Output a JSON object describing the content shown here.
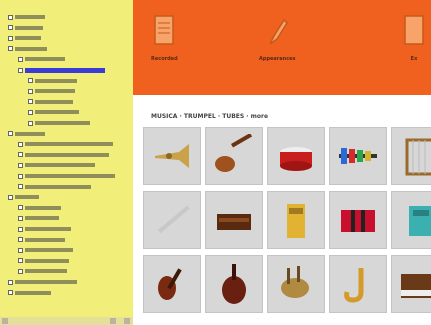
{
  "sidebar": {
    "items": [
      {
        "depth": 0,
        "w": 30
      },
      {
        "depth": 0,
        "w": 28
      },
      {
        "depth": 0,
        "w": 26
      },
      {
        "depth": 0,
        "w": 32
      },
      {
        "depth": 1,
        "w": 40
      },
      {
        "depth": 1,
        "w": 80,
        "selected": true
      },
      {
        "depth": 2,
        "w": 42
      },
      {
        "depth": 2,
        "w": 40
      },
      {
        "depth": 2,
        "w": 38
      },
      {
        "depth": 2,
        "w": 44
      },
      {
        "depth": 2,
        "w": 55
      },
      {
        "depth": 0,
        "w": 30
      },
      {
        "depth": 1,
        "w": 88
      },
      {
        "depth": 1,
        "w": 84
      },
      {
        "depth": 1,
        "w": 70
      },
      {
        "depth": 1,
        "w": 90
      },
      {
        "depth": 1,
        "w": 66
      },
      {
        "depth": 0,
        "w": 24
      },
      {
        "depth": 1,
        "w": 36
      },
      {
        "depth": 1,
        "w": 34
      },
      {
        "depth": 1,
        "w": 46
      },
      {
        "depth": 1,
        "w": 40
      },
      {
        "depth": 1,
        "w": 48
      },
      {
        "depth": 1,
        "w": 44
      },
      {
        "depth": 1,
        "w": 42
      },
      {
        "depth": 0,
        "w": 62
      },
      {
        "depth": 0,
        "w": 36
      }
    ]
  },
  "toolbar": {
    "buttons": [
      {
        "label": "Recorded",
        "icon": "document-icon"
      },
      {
        "label": "Appearances",
        "icon": "pen-icon"
      },
      {
        "label": "Ex",
        "icon": "document-icon"
      }
    ]
  },
  "content": {
    "breadcrumb": "MUSICA · TRUMPEL · TUBES · more",
    "tiles": [
      {
        "icon": "trumpet-icon"
      },
      {
        "icon": "mandolin-icon"
      },
      {
        "icon": "drum-icon"
      },
      {
        "icon": "xylophone-icon"
      },
      {
        "icon": "harp-icon"
      },
      {
        "icon": "flute-icon"
      },
      {
        "icon": "chest-icon"
      },
      {
        "icon": "bottle-icon"
      },
      {
        "icon": "accordion-icon"
      },
      {
        "icon": "case-icon"
      },
      {
        "icon": "violin-icon"
      },
      {
        "icon": "cello-icon"
      },
      {
        "icon": "bagpipe-icon"
      },
      {
        "icon": "saxophone-icon"
      },
      {
        "icon": "piano-icon"
      }
    ]
  },
  "colors": {
    "sidebar_bg": "#f2ee7a",
    "toolbar_bg": "#f0611f",
    "selection": "#3b3bd6"
  }
}
